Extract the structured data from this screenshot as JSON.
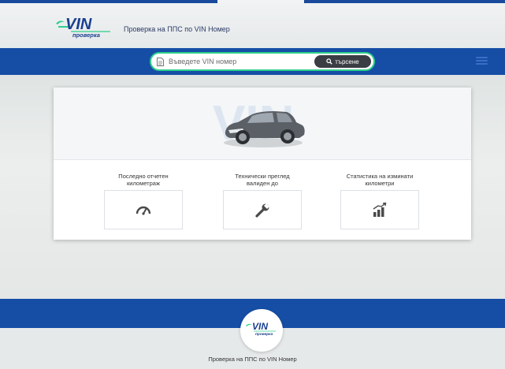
{
  "brand": {
    "logo_top": "VIN",
    "logo_bottom": "проверка",
    "accent_green": "#2fcf8a",
    "brand_blue": "#164ea6"
  },
  "header": {
    "title": "Проверка на ППС по VIN Номер"
  },
  "search": {
    "placeholder": "Въведете VIN номер",
    "button_label": "търсене",
    "button_icon": "search-icon",
    "field_icon": "document-icon"
  },
  "hero": {
    "watermark": "VIN"
  },
  "features": [
    {
      "label_line1": "Последно отчетен",
      "label_line2": "километраж",
      "icon": "speedometer-icon"
    },
    {
      "label_line1": "Технически преглед",
      "label_line2": "валиден до",
      "icon": "wrench-icon"
    },
    {
      "label_line1": "Статистика на изминати",
      "label_line2": "километри",
      "icon": "bar-chart-icon"
    }
  ],
  "footer": {
    "text": "Проверка на ППС по VIN Номер"
  }
}
